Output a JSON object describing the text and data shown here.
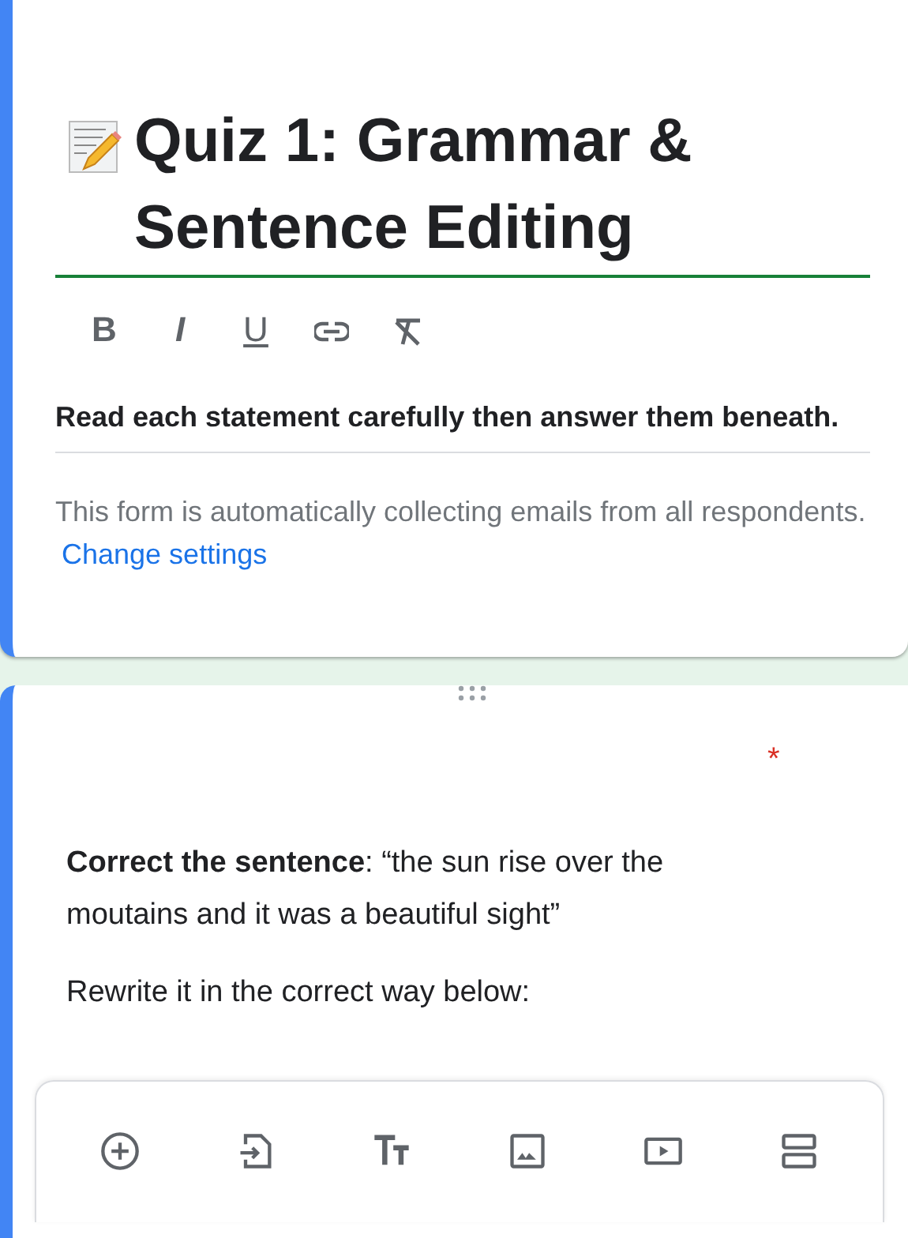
{
  "header_card": {
    "title": "Quiz 1: Grammar & Sentence Editing",
    "format_buttons": [
      {
        "kind": "bold",
        "label": "B"
      },
      {
        "kind": "italic",
        "label": "I"
      },
      {
        "kind": "underline",
        "label": "U"
      },
      {
        "kind": "link"
      },
      {
        "kind": "clear"
      }
    ],
    "description": "Read each statement carefully then answer them beneath.",
    "notice": "This form is automatically collecting emails from all respondents.",
    "notice_link": "Change settings"
  },
  "question_card": {
    "required_mark": "*",
    "question": "**Correct the sentence**: “the sun rise over the moutains and it was a beautiful sight”",
    "instruction": "Rewrite it in the correct way below:"
  },
  "add_toolbar": [
    {
      "kind": "add"
    },
    {
      "kind": "import"
    },
    {
      "kind": "title"
    },
    {
      "kind": "image"
    },
    {
      "kind": "video"
    },
    {
      "kind": "section"
    }
  ]
}
